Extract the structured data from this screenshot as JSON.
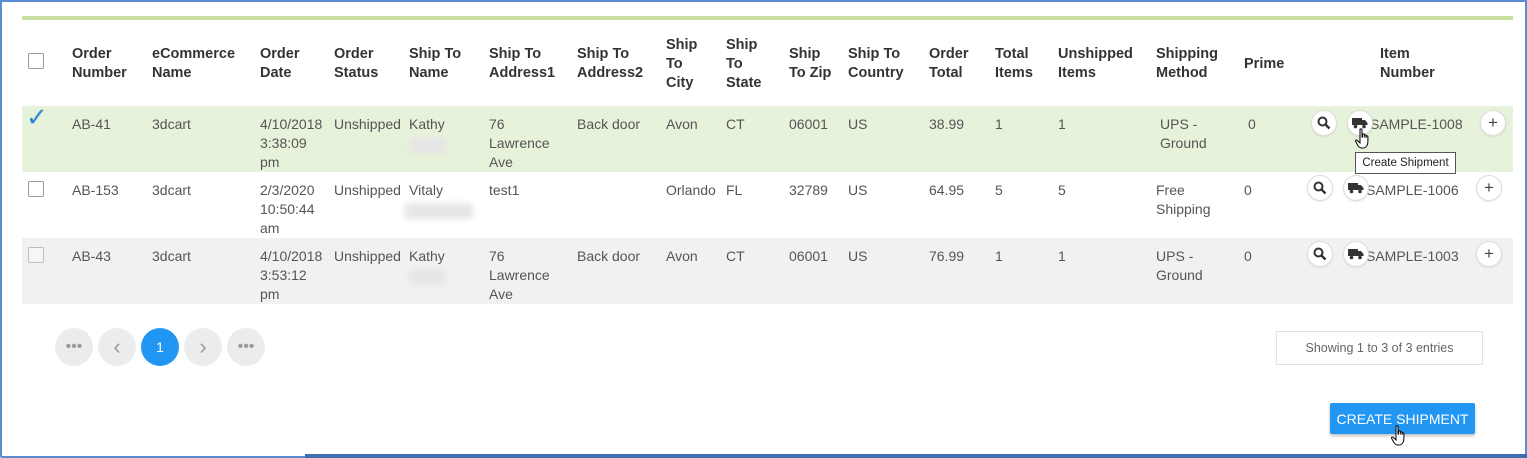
{
  "headers": [
    "",
    "Order Number",
    "eCommerce Name",
    "Order Date",
    "Order Status",
    "Ship To Name",
    "Ship To Address1",
    "Ship To Address2",
    "Ship To City",
    "Ship To State",
    "Ship To Zip",
    "Ship To Country",
    "Order Total",
    "Total Items",
    "Unshipped Items",
    "Shipping Method",
    "Prime",
    "",
    "Item Number",
    ""
  ],
  "rows": [
    {
      "order_number": "AB-41",
      "ecommerce": "3dcart",
      "order_date": "4/10/2018 3:38:09 pm",
      "status": "Unshipped",
      "name": "Kathy",
      "address1": "76 Lawrence Ave",
      "address2": "Back door",
      "city": "Avon",
      "state": "CT",
      "zip": "06001",
      "country": "US",
      "total": "38.99",
      "total_items": "1",
      "unshipped": "1",
      "method": "UPS - Ground",
      "prime": "0",
      "item_number": "SAMPLE-1008",
      "checked": true
    },
    {
      "order_number": "AB-153",
      "ecommerce": "3dcart",
      "order_date": "2/3/2020 10:50:44 am",
      "status": "Unshipped",
      "name": "Vitaly",
      "address1": "test1",
      "address2": "",
      "city": "Orlando",
      "state": "FL",
      "zip": "32789",
      "country": "US",
      "total": "64.95",
      "total_items": "5",
      "unshipped": "5",
      "method": "Free Shipping",
      "prime": "0",
      "item_number": "SAMPLE-1006",
      "checked": false
    },
    {
      "order_number": "AB-43",
      "ecommerce": "3dcart",
      "order_date": "4/10/2018 3:53:12 pm",
      "status": "Unshipped",
      "name": "Kathy",
      "address1": "76 Lawrence Ave",
      "address2": "Back door",
      "city": "Avon",
      "state": "CT",
      "zip": "06001",
      "country": "US",
      "total": "76.99",
      "total_items": "1",
      "unshipped": "1",
      "method": "UPS - Ground",
      "prime": "0",
      "item_number": "SAMPLE-1003",
      "checked": false
    }
  ],
  "tooltip": "Create Shipment",
  "pagination": {
    "first": "•••",
    "prev": "‹",
    "page": "1",
    "next": "›",
    "last": "•••"
  },
  "entries_info": "Showing 1 to 3 of 3 entries",
  "create_button": "CREATE SHIPMENT",
  "icons": {
    "search": "search-icon",
    "truck": "truck-icon",
    "add": "plus-icon"
  },
  "colors": {
    "accent": "#2196f3",
    "selected_row": "#e7f2da",
    "top_rule": "#c9df9f"
  }
}
